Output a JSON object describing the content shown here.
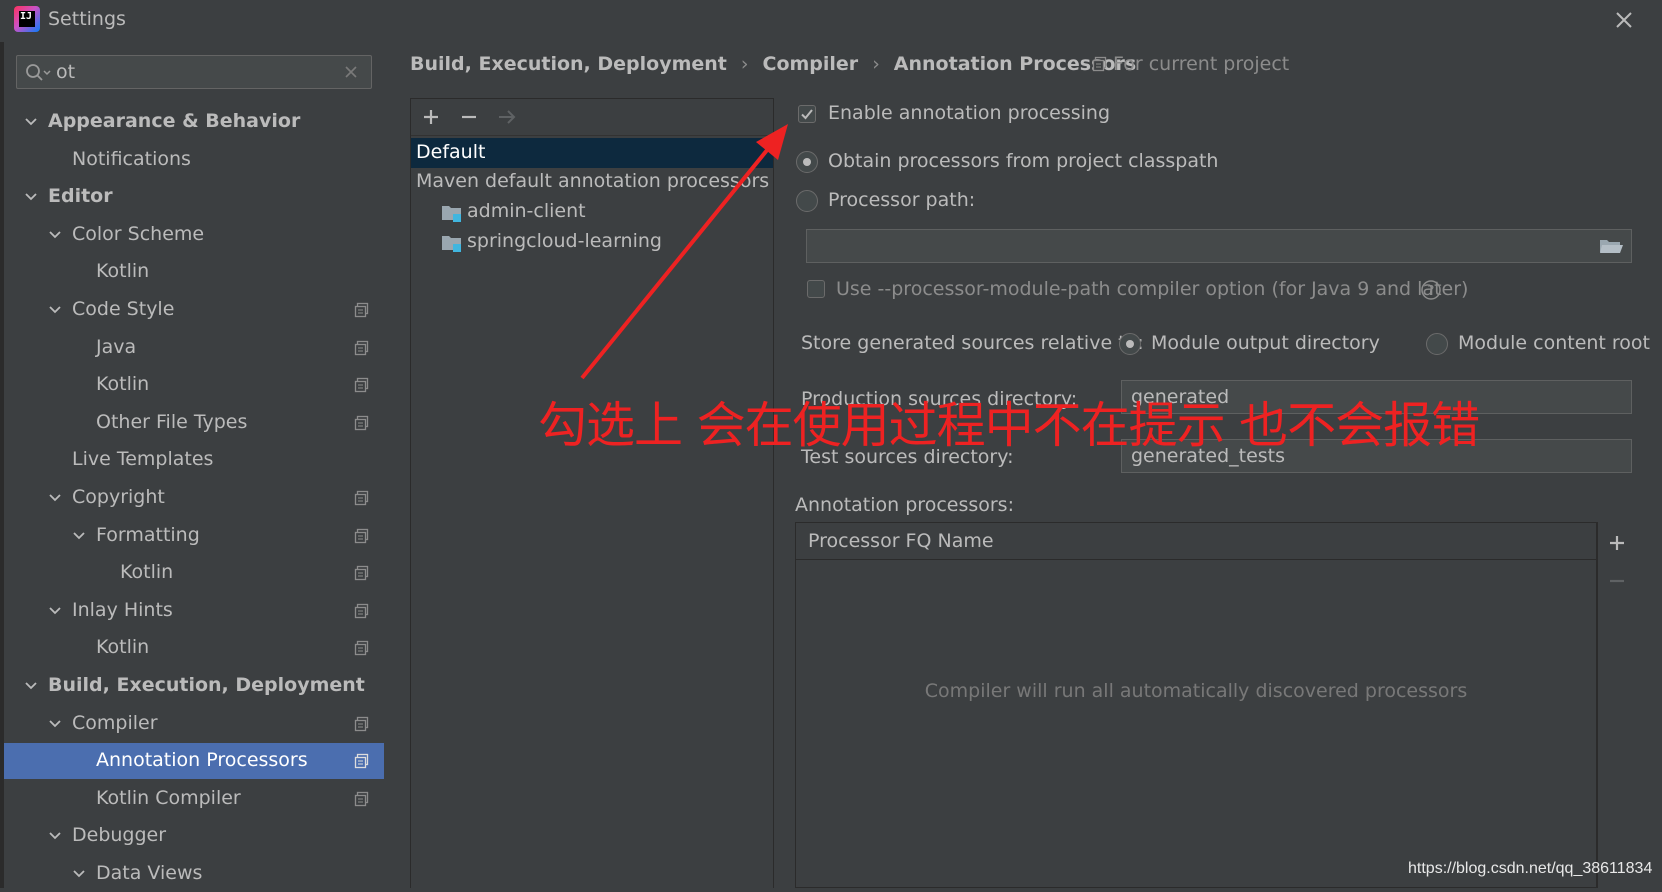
{
  "window": {
    "title": "Settings"
  },
  "search": {
    "value": "ot"
  },
  "sidebar": {
    "items": [
      {
        "label": "Appearance & Behavior",
        "bold": true,
        "level": 0,
        "expandable": true,
        "project": false
      },
      {
        "label": "Notifications",
        "bold": false,
        "level": 1,
        "expandable": false,
        "project": false
      },
      {
        "label": "Editor",
        "bold": true,
        "level": 0,
        "expandable": true,
        "project": false
      },
      {
        "label": "Color Scheme",
        "bold": false,
        "level": 1,
        "expandable": true,
        "project": false
      },
      {
        "label": "Kotlin",
        "bold": false,
        "level": 2,
        "expandable": false,
        "project": false
      },
      {
        "label": "Code Style",
        "bold": false,
        "level": 1,
        "expandable": true,
        "project": true
      },
      {
        "label": "Java",
        "bold": false,
        "level": 2,
        "expandable": false,
        "project": true
      },
      {
        "label": "Kotlin",
        "bold": false,
        "level": 2,
        "expandable": false,
        "project": true
      },
      {
        "label": "Other File Types",
        "bold": false,
        "level": 2,
        "expandable": false,
        "project": true
      },
      {
        "label": "Live Templates",
        "bold": false,
        "level": 1,
        "expandable": false,
        "project": false
      },
      {
        "label": "Copyright",
        "bold": false,
        "level": 1,
        "expandable": true,
        "project": true
      },
      {
        "label": "Formatting",
        "bold": false,
        "level": 2,
        "expandable": true,
        "project": true
      },
      {
        "label": "Kotlin",
        "bold": false,
        "level": 3,
        "expandable": false,
        "project": true
      },
      {
        "label": "Inlay Hints",
        "bold": false,
        "level": 1,
        "expandable": true,
        "project": true
      },
      {
        "label": "Kotlin",
        "bold": false,
        "level": 2,
        "expandable": false,
        "project": true
      },
      {
        "label": "Build, Execution, Deployment",
        "bold": true,
        "level": 0,
        "expandable": true,
        "project": false
      },
      {
        "label": "Compiler",
        "bold": false,
        "level": 1,
        "expandable": true,
        "project": true
      },
      {
        "label": "Annotation Processors",
        "bold": false,
        "level": 2,
        "expandable": false,
        "project": true,
        "selected": true
      },
      {
        "label": "Kotlin Compiler",
        "bold": false,
        "level": 2,
        "expandable": false,
        "project": true
      },
      {
        "label": "Debugger",
        "bold": false,
        "level": 1,
        "expandable": true,
        "project": false
      },
      {
        "label": "Data Views",
        "bold": false,
        "level": 2,
        "expandable": true,
        "project": false
      }
    ]
  },
  "breadcrumb": {
    "parts": [
      "Build, Execution, Deployment",
      "Compiler",
      "Annotation Processors"
    ],
    "separator": "›",
    "scope": "For current project"
  },
  "profiles": {
    "rows": [
      {
        "label": "Default",
        "selected": true,
        "folder": false
      },
      {
        "label": "Maven default annotation processors profile",
        "selected": false,
        "folder": false
      },
      {
        "label": "admin-client",
        "selected": false,
        "folder": true
      },
      {
        "label": "springcloud-learning",
        "selected": false,
        "folder": true
      }
    ]
  },
  "form": {
    "enable_label": "Enable annotation processing",
    "enable_checked": true,
    "obtain_label": "Obtain processors from project classpath",
    "processor_path_label": "Processor path:",
    "processor_path_value": "",
    "module_path_label": "Use --processor-module-path compiler option (for Java 9 and later)",
    "store_label": "Store generated sources relative to:",
    "module_output_label": "Module output directory",
    "module_content_label": "Module content root",
    "production_label": "Production sources directory:",
    "production_value": "generated",
    "test_label": "Test sources directory:",
    "test_value": "generated_tests",
    "processors_label": "Annotation processors:"
  },
  "processors_table": {
    "header": "Processor FQ Name",
    "empty_text": "Compiler will run all automatically discovered processors"
  },
  "annotation": {
    "text": "勾选上 会在使用过程中不在提示 也不会报错",
    "color": "#ee2222"
  },
  "watermark": "https://blog.csdn.net/qq_38611834",
  "colors": {
    "background": "#3c3f41",
    "selection": "#4b6eaf",
    "list_selection": "#0d293e",
    "text": "#bbbbbb"
  }
}
